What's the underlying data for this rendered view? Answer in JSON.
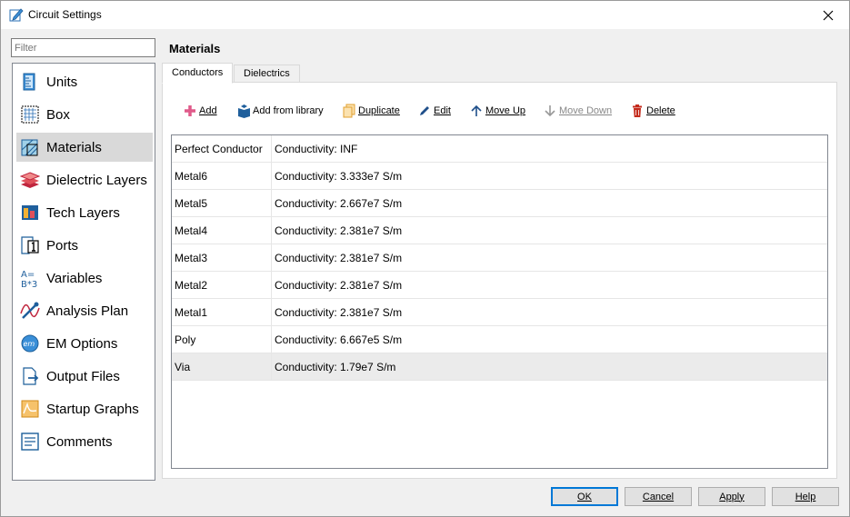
{
  "window": {
    "title": "Circuit Settings"
  },
  "filter": {
    "placeholder": "Filter"
  },
  "sidebar": {
    "items": [
      {
        "label": "Units",
        "icon": "ruler-beaker-icon"
      },
      {
        "label": "Box",
        "icon": "grid-box-icon"
      },
      {
        "label": "Materials",
        "icon": "materials-icon",
        "selected": true
      },
      {
        "label": "Dielectric Layers",
        "icon": "stacked-layers-icon"
      },
      {
        "label": "Tech Layers",
        "icon": "tech-layers-icon"
      },
      {
        "label": "Ports",
        "icon": "port-icon"
      },
      {
        "label": "Variables",
        "icon": "variables-icon"
      },
      {
        "label": "Analysis Plan",
        "icon": "analysis-plan-icon"
      },
      {
        "label": "EM Options",
        "icon": "em-options-icon"
      },
      {
        "label": "Output Files",
        "icon": "output-files-icon"
      },
      {
        "label": "Startup Graphs",
        "icon": "startup-graphs-icon"
      },
      {
        "label": "Comments",
        "icon": "comments-icon"
      }
    ]
  },
  "main": {
    "heading": "Materials",
    "tabs": [
      {
        "label": "Conductors",
        "active": true
      },
      {
        "label": "Dielectrics",
        "active": false
      }
    ],
    "toolbar": {
      "add": "Add",
      "add_from_library": "Add from library",
      "duplicate": "Duplicate",
      "edit": "Edit",
      "move_up": "Move Up",
      "move_down": "Move Down",
      "delete": "Delete"
    },
    "rows": [
      {
        "name": "Perfect Conductor",
        "value": "Conductivity: INF"
      },
      {
        "name": "Metal6",
        "value": "Conductivity: 3.333e7 S/m"
      },
      {
        "name": "Metal5",
        "value": "Conductivity: 2.667e7 S/m"
      },
      {
        "name": "Metal4",
        "value": "Conductivity: 2.381e7 S/m"
      },
      {
        "name": "Metal3",
        "value": "Conductivity: 2.381e7 S/m"
      },
      {
        "name": "Metal2",
        "value": "Conductivity: 2.381e7 S/m"
      },
      {
        "name": "Metal1",
        "value": "Conductivity: 2.381e7 S/m"
      },
      {
        "name": "Poly",
        "value": "Conductivity: 6.667e5 S/m"
      },
      {
        "name": "Via",
        "value": "Conductivity: 1.79e7 S/m",
        "selected": true
      }
    ]
  },
  "footer": {
    "ok": "OK",
    "cancel": "Cancel",
    "apply": "Apply",
    "help": "Help"
  },
  "colors": {
    "accent": "#0078d7",
    "delete": "#c42b1c",
    "add": "#e05a8a",
    "selection": "#d9d9d9"
  }
}
